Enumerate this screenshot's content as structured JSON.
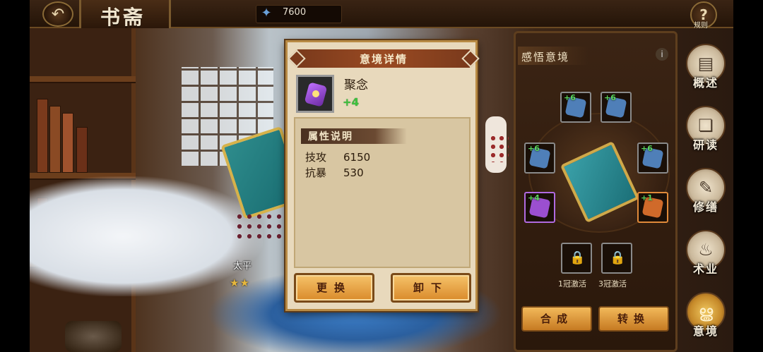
{
  "header": {
    "title": "书斋",
    "currency_icon": "spirit-jade-icon",
    "currency_value": "7600",
    "rules_label": "规则"
  },
  "scene": {
    "character_name": "太平",
    "character_stars": "★★"
  },
  "modal": {
    "title": "意境详情",
    "item": {
      "name": "聚念",
      "level": "+4",
      "icon": "purple-gem-icon"
    },
    "attributes_header": "属性说明",
    "attributes": [
      {
        "key": "技攻",
        "value": "6150"
      },
      {
        "key": "抗暴",
        "value": "530"
      }
    ],
    "buttons": {
      "replace": "更换",
      "unequip": "卸下"
    }
  },
  "right_panel": {
    "title": "感悟意境",
    "slots": [
      {
        "level": "+6",
        "color": "#4f7fb8"
      },
      {
        "level": "+6",
        "color": "#4f7fb8"
      },
      {
        "level": "+6",
        "color": "#4f7fb8"
      },
      {
        "level": "+6",
        "color": "#4f7fb8"
      },
      {
        "level": "+4",
        "color": "#9b4fd0"
      },
      {
        "level": "+1",
        "color": "#d06a2a"
      }
    ],
    "locked_captions": [
      "1冠激活",
      "3冠激活"
    ],
    "buttons": {
      "combine": "合成",
      "convert": "转换"
    }
  },
  "nav": [
    {
      "label": "概述",
      "icon": "scroll-icon"
    },
    {
      "label": "研读",
      "icon": "open-book-icon"
    },
    {
      "label": "修缮",
      "icon": "repair-icon"
    },
    {
      "label": "术业",
      "icon": "flame-icon"
    },
    {
      "label": "意境",
      "icon": "spiral-icon"
    }
  ]
}
